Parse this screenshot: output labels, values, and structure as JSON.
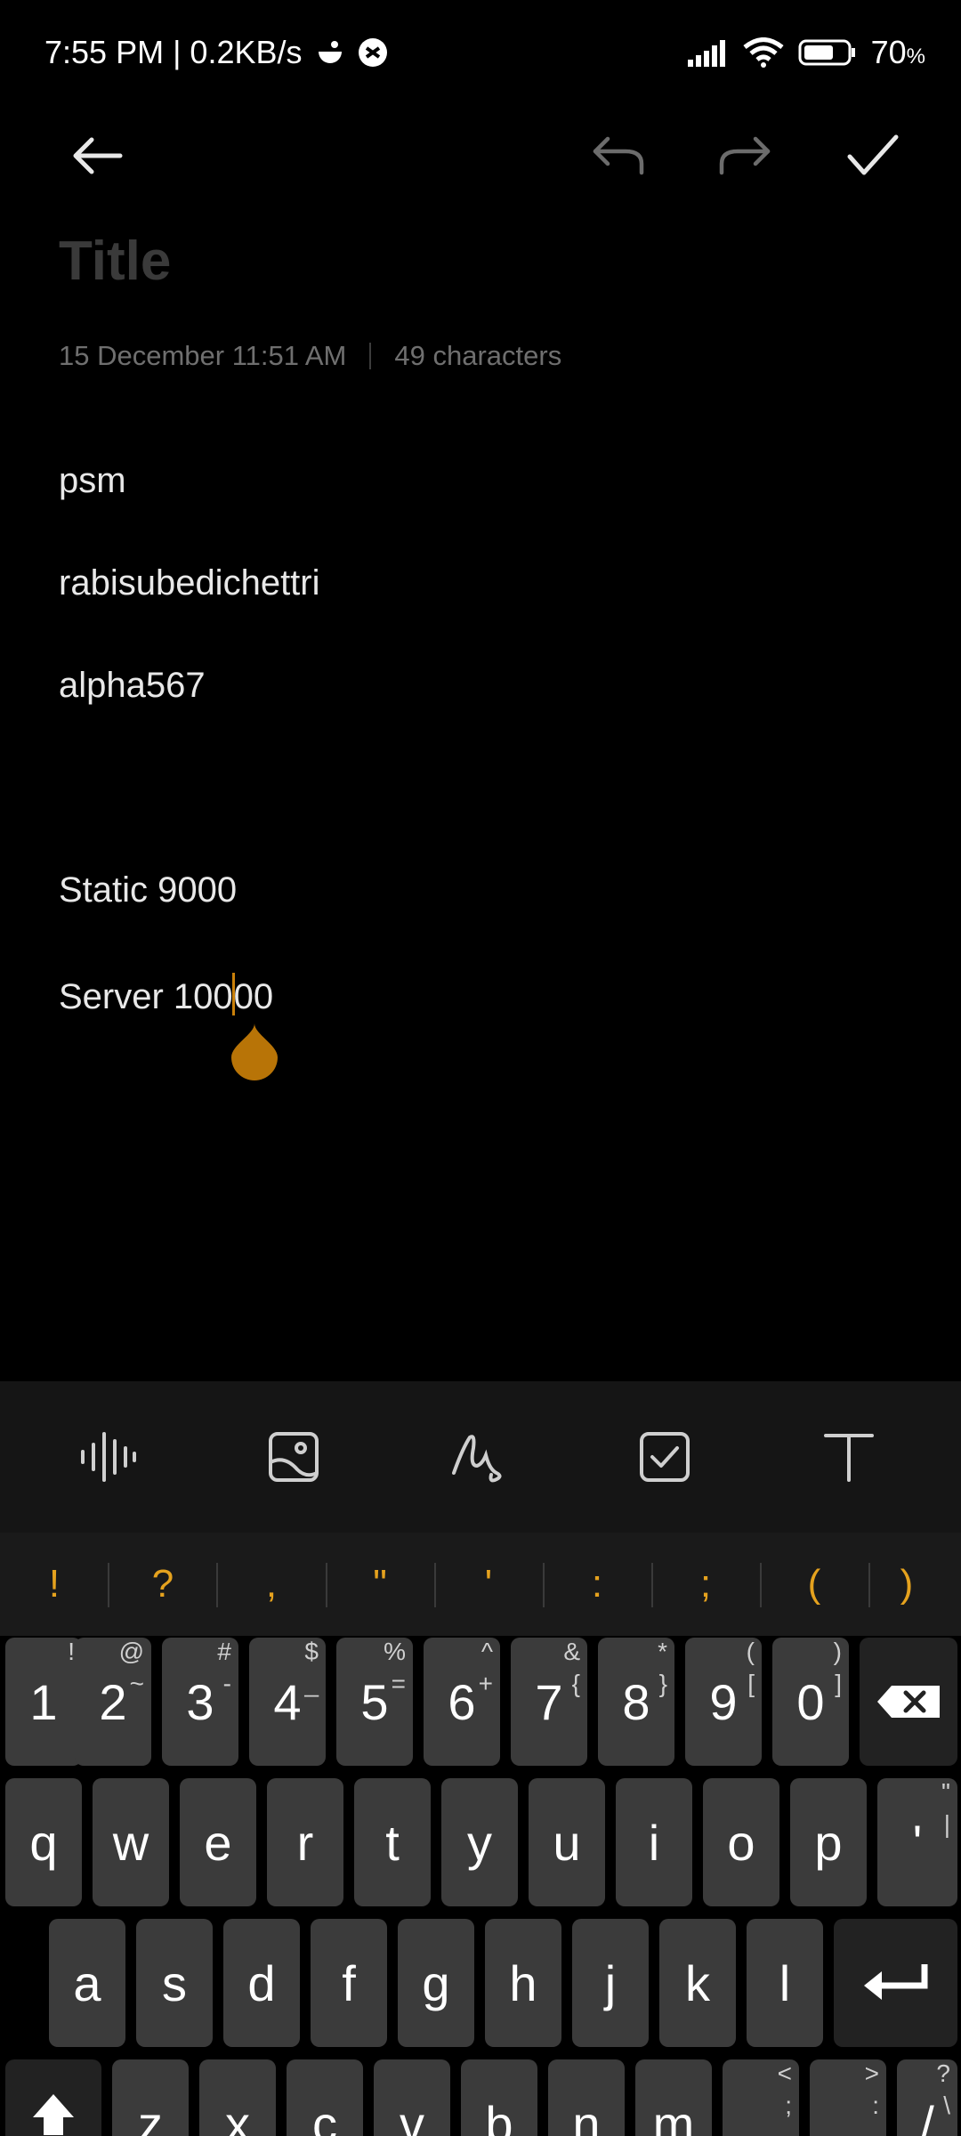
{
  "status": {
    "time_speed": "7:55 PM | 0.2KB/s",
    "battery": "70",
    "battery_unit": "%"
  },
  "toolbar": {
    "back_icon": "arrow-left-icon",
    "undo_icon": "undo-icon",
    "redo_icon": "redo-icon",
    "done_icon": "checkmark-icon"
  },
  "note": {
    "title_placeholder": "Title",
    "date": "15 December 11:51 AM",
    "char_count": "49 characters",
    "lines": [
      "psm",
      "rabisubedichettri",
      "alpha567",
      "Static 9000"
    ],
    "last_line_before_cursor": "Server 100",
    "last_line_after_cursor": "00"
  },
  "format_bar": {
    "icons": [
      "audio-wave-icon",
      "image-icon",
      "handwriting-icon",
      "checkbox-icon",
      "text-format-icon"
    ]
  },
  "keyboard": {
    "symbols": [
      "!",
      "?",
      ",",
      "\"",
      "'",
      ":",
      ";",
      "(",
      ")"
    ],
    "number_row": [
      {
        "main": "1",
        "alt": "!",
        "alt2": ""
      },
      {
        "main": "2",
        "alt": "@",
        "alt2": "~"
      },
      {
        "main": "3",
        "alt": "#",
        "alt2": "-"
      },
      {
        "main": "4",
        "alt": "$",
        "alt2": "_"
      },
      {
        "main": "5",
        "alt": "%",
        "alt2": "="
      },
      {
        "main": "6",
        "alt": "^",
        "alt2": "+"
      },
      {
        "main": "7",
        "alt": "&",
        "alt2": "{"
      },
      {
        "main": "8",
        "alt": "*",
        "alt2": "}"
      },
      {
        "main": "9",
        "alt": "(",
        "alt2": "["
      },
      {
        "main": "0",
        "alt": ")",
        "alt2": "]"
      }
    ],
    "row_q": [
      "q",
      "w",
      "e",
      "r",
      "t",
      "y",
      "u",
      "i",
      "o",
      "p"
    ],
    "quote_key": {
      "main": "'",
      "alt": "\"",
      "alt2": "|"
    },
    "row_a": [
      "a",
      "s",
      "d",
      "f",
      "g",
      "h",
      "j",
      "k",
      "l"
    ],
    "row_z": [
      "z",
      "x",
      "c",
      "v",
      "b",
      "n",
      "m"
    ],
    "row_z_extra": [
      {
        "main": "",
        "alt": "<",
        "alt2": ";"
      },
      {
        "main": "",
        "alt": ">",
        "alt2": ":"
      },
      {
        "main": "/",
        "alt": "?",
        "alt2": "\\"
      }
    ]
  }
}
